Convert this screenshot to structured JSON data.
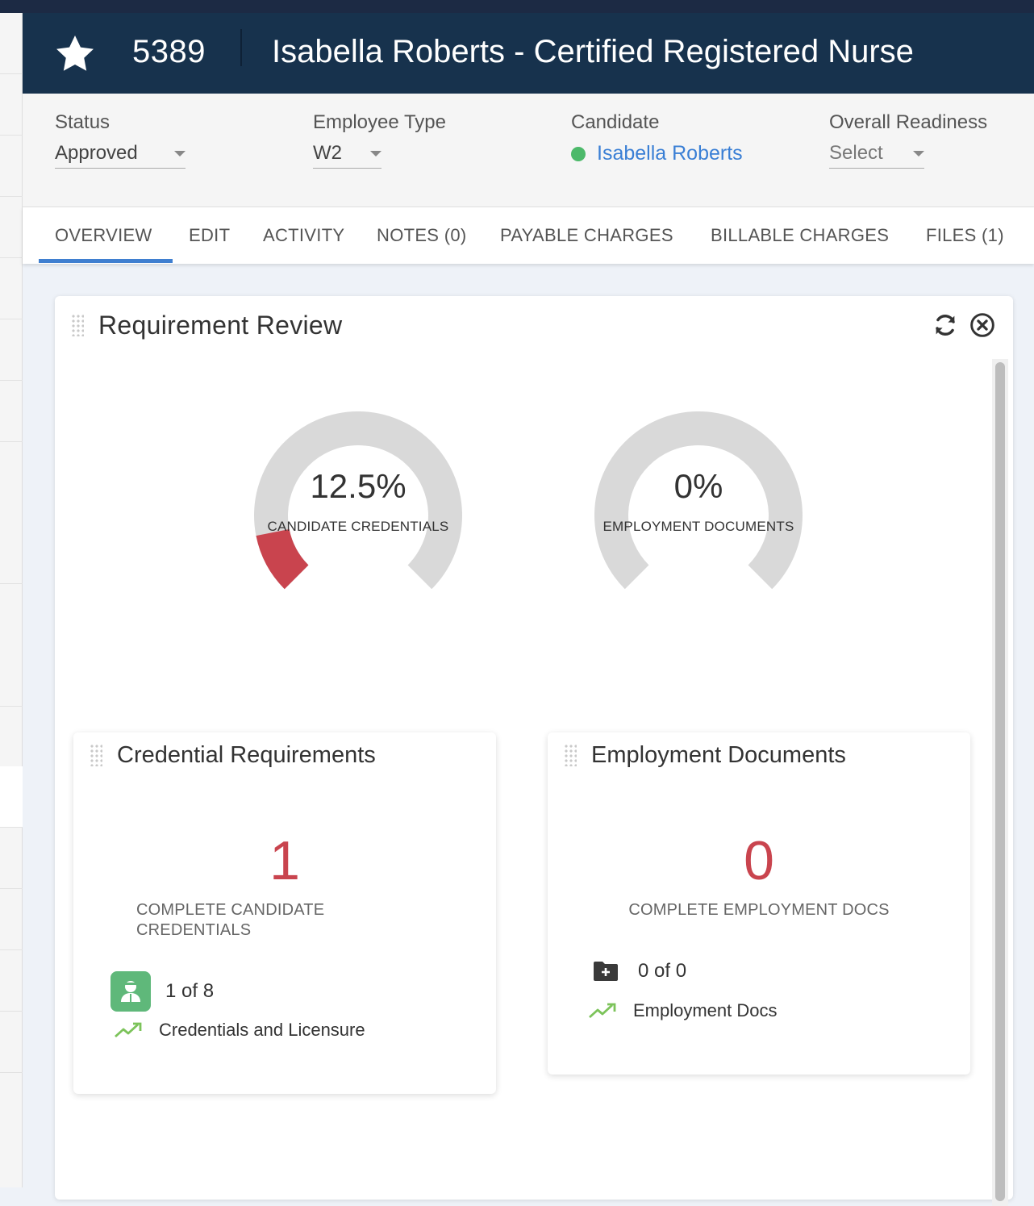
{
  "header": {
    "record_id": "5389",
    "title": "Isabella Roberts - Certified Registered Nurse"
  },
  "info": {
    "status": {
      "label": "Status",
      "value": "Approved"
    },
    "employee_type": {
      "label": "Employee Type",
      "value": "W2"
    },
    "candidate": {
      "label": "Candidate",
      "value": "Isabella Roberts",
      "status_color": "#4cb96a"
    },
    "overall_readiness": {
      "label": "Overall Readiness",
      "value": "Select"
    }
  },
  "tabs": [
    {
      "label": "OVERVIEW",
      "active": true
    },
    {
      "label": "EDIT"
    },
    {
      "label": "ACTIVITY"
    },
    {
      "label": "NOTES (0)"
    },
    {
      "label": "PAYABLE CHARGES"
    },
    {
      "label": "BILLABLE CHARGES"
    },
    {
      "label": "FILES (1)"
    }
  ],
  "panel": {
    "title": "Requirement Review",
    "gauges": [
      {
        "value_text": "12.5%",
        "value": 12.5,
        "label": "CANDIDATE CREDENTIALS",
        "color": "#c9444e"
      },
      {
        "value_text": "0%",
        "value": 0,
        "label": "EMPLOYMENT DOCUMENTS",
        "color": "#c9444e"
      }
    ]
  },
  "cards": {
    "credentials": {
      "title": "Credential Requirements",
      "count": "1",
      "caption_line1": "COMPLETE CANDIDATE",
      "caption_line2": "CREDENTIALS",
      "stat": "1 of 8",
      "trend_label": "Credentials and Licensure",
      "icon": "user-badge-icon"
    },
    "employment": {
      "title": "Employment Documents",
      "count": "0",
      "caption": "COMPLETE EMPLOYMENT DOCS",
      "stat": "0 of 0",
      "trend_label": "Employment Docs",
      "icon": "folder-plus-icon"
    }
  },
  "colors": {
    "header_bg": "#17324d",
    "accent": "#3f7fd0",
    "alert": "#c9444e",
    "success": "#4cb96a"
  }
}
